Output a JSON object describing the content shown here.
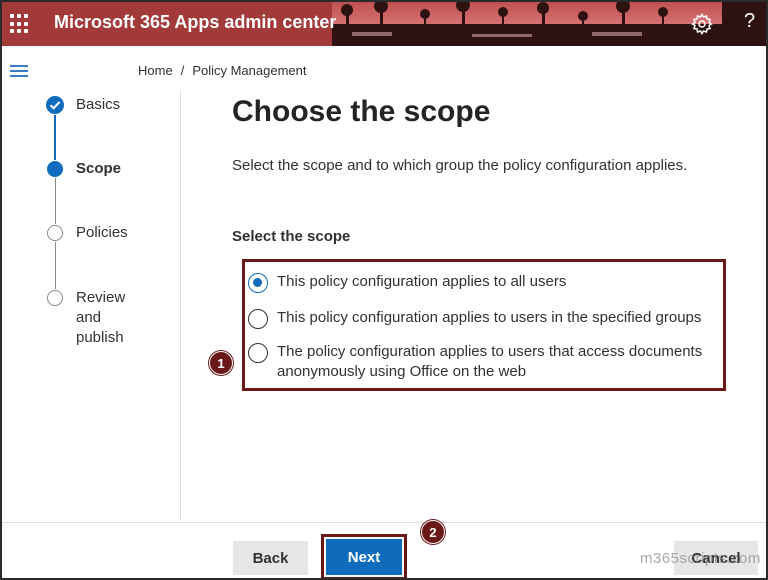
{
  "header": {
    "app_title": "Microsoft 365 Apps admin center",
    "icons": [
      "app-launcher-icon",
      "settings-icon",
      "help-icon"
    ],
    "help_glyph": "?",
    "brand_color": "#a23a3a"
  },
  "breadcrumb": {
    "home": "Home",
    "separator": "/",
    "current": "Policy Management"
  },
  "stepper": {
    "steps": [
      {
        "label": "Basics",
        "state": "completed"
      },
      {
        "label": "Scope",
        "state": "current"
      },
      {
        "label": "Policies",
        "state": "pending"
      },
      {
        "label": "Review\nand\npublish",
        "state": "pending"
      }
    ]
  },
  "main": {
    "title": "Choose the scope",
    "description": "Select the scope and to which group the policy configuration applies.",
    "scope_label": "Select the scope",
    "options": [
      {
        "label": "This policy configuration applies to all users",
        "selected": true
      },
      {
        "label": "This policy configuration applies to users in the specified groups",
        "selected": false
      },
      {
        "label": "The policy configuration applies to users that access documents anonymously using Office on the web",
        "selected": false
      }
    ]
  },
  "callouts": {
    "first": "1",
    "second": "2"
  },
  "footer": {
    "back_label": "Back",
    "next_label": "Next",
    "cancel_label": "Cancel",
    "watermark": "m365scripts.com"
  },
  "colors": {
    "accent": "#0f6cbd",
    "highlight": "#6b1818"
  }
}
